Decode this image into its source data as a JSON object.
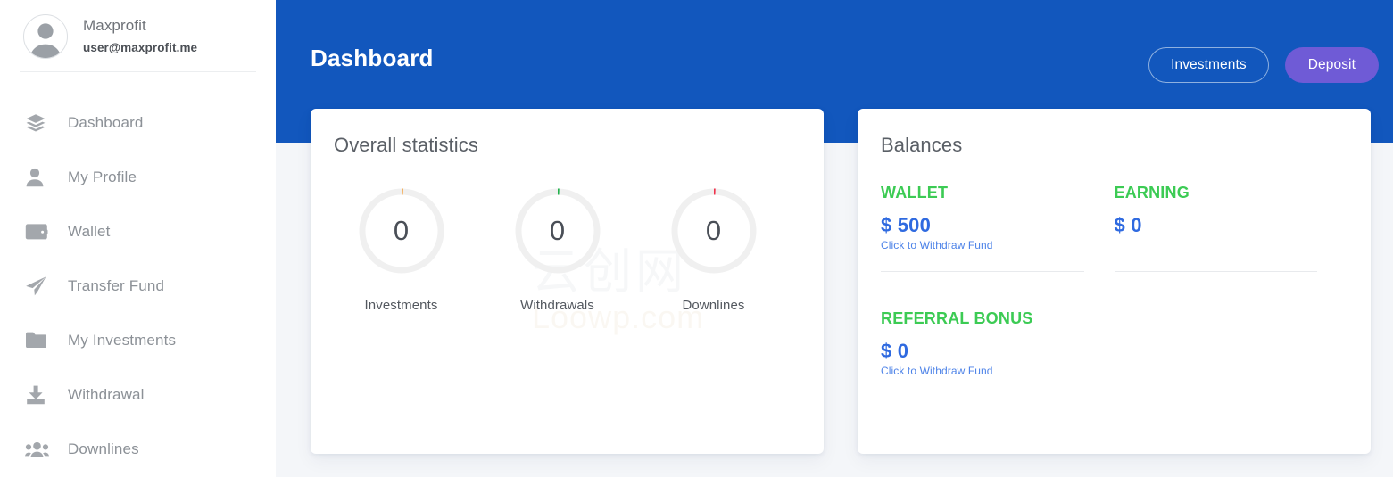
{
  "sidebar": {
    "profile": {
      "avatar_icon": "user-avatar-icon",
      "name": "Maxprofit",
      "email": "user@maxprofit.me"
    },
    "items": [
      {
        "label": "Dashboard",
        "icon": "layers-icon"
      },
      {
        "label": "My Profile",
        "icon": "person-icon"
      },
      {
        "label": "Wallet",
        "icon": "wallet-icon"
      },
      {
        "label": "Transfer Fund",
        "icon": "paper-plane-icon"
      },
      {
        "label": "My Investments",
        "icon": "folder-icon"
      },
      {
        "label": "Withdrawal",
        "icon": "download-tray-icon"
      },
      {
        "label": "Downlines",
        "icon": "people-group-icon"
      }
    ]
  },
  "header": {
    "title": "Dashboard",
    "investments_label": "Investments",
    "deposit_label": "Deposit",
    "background_color": "#1257bd",
    "deposit_color": "#6f5bd6"
  },
  "stats_card": {
    "title": "Overall statistics",
    "watermark_line1": "云创网",
    "watermark_line2": "Loowp.com"
  },
  "balances_card": {
    "title": "Balances",
    "withdraw_link": "Click to Withdraw Fund",
    "label_color": "#3ccb54",
    "amount_color": "#2f6ae0",
    "entries": [
      {
        "label": "WALLET",
        "amount": "$ 500",
        "has_link": true
      },
      {
        "label": "EARNING",
        "amount": "$ 0",
        "has_link": false
      },
      {
        "label": "REFERRAL BONUS",
        "amount": "$ 0",
        "has_link": true
      }
    ]
  },
  "chart_data": {
    "type": "pie",
    "title": "Overall statistics",
    "charts": [
      {
        "label": "Investments",
        "value": 0,
        "accent_color": "#f7941e",
        "track_color": "#f0f0f0"
      },
      {
        "label": "Withdrawals",
        "value": 0,
        "accent_color": "#22b14c",
        "track_color": "#f0f0f0"
      },
      {
        "label": "Downlines",
        "value": 0,
        "accent_color": "#f0334c",
        "track_color": "#f0f0f0"
      }
    ],
    "max": 100,
    "legend": "none",
    "grid": false
  }
}
